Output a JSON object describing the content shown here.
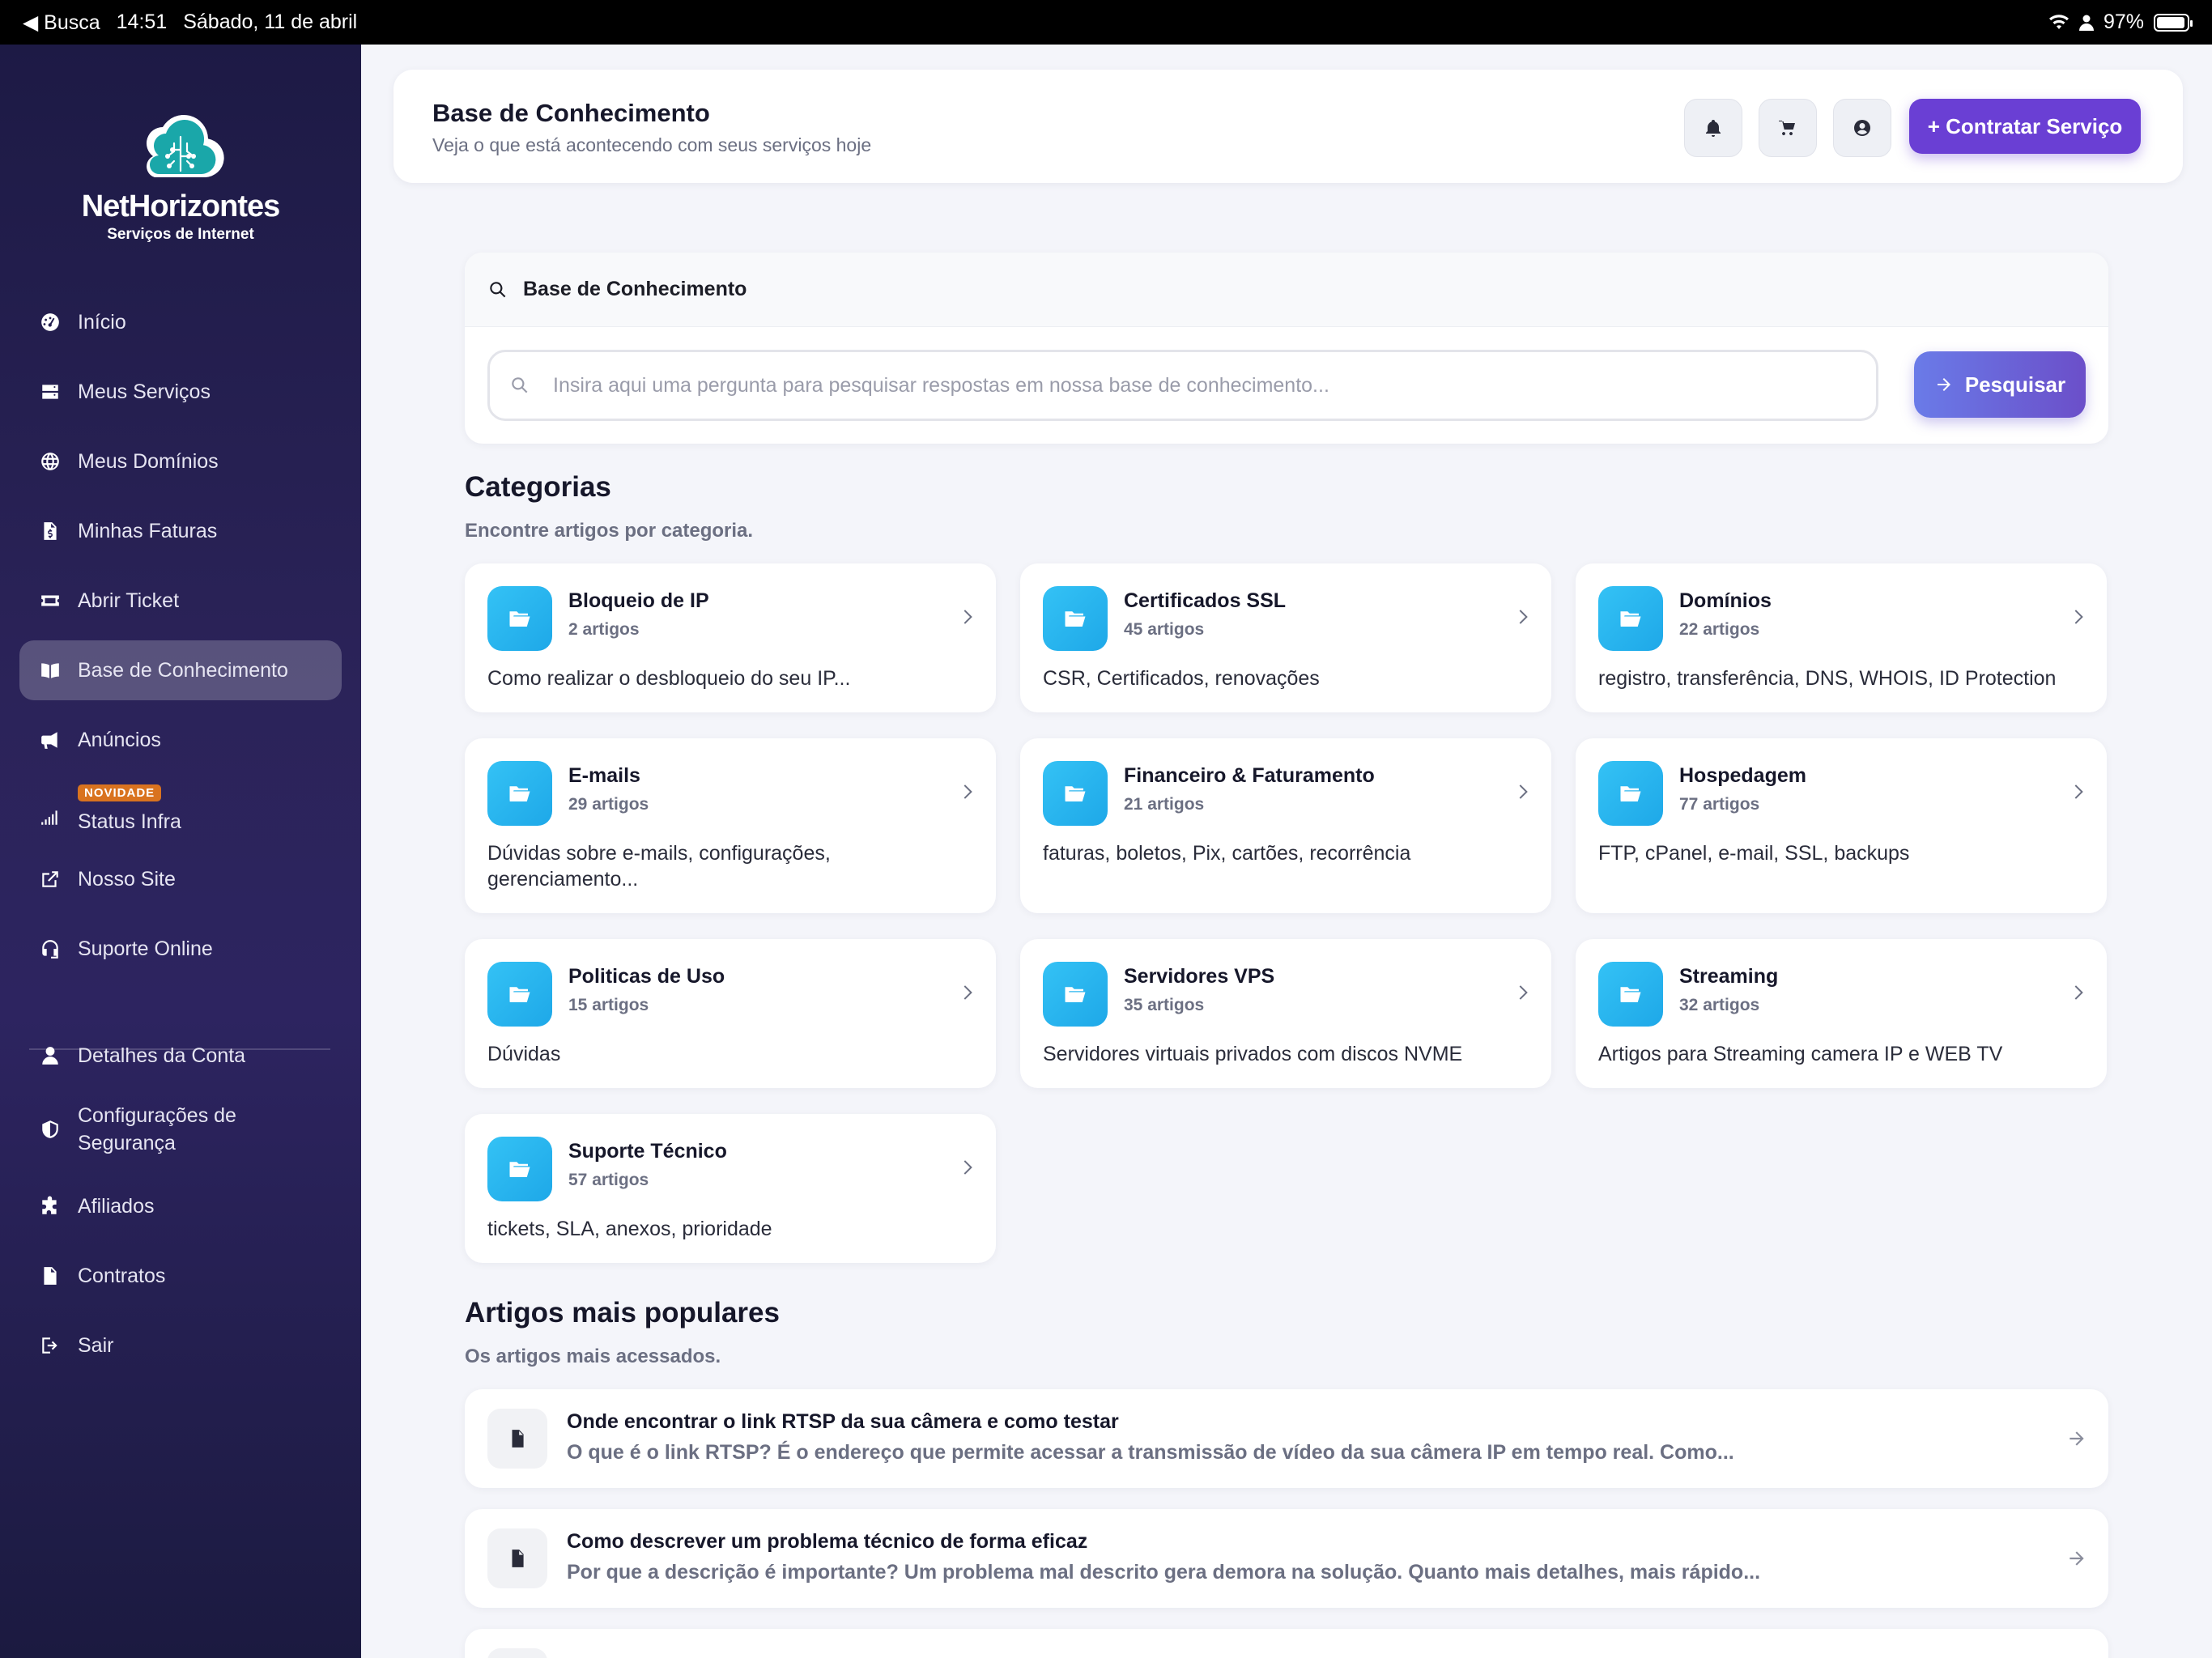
{
  "status_bar": {
    "back": "◀ Busca",
    "time": "14:51",
    "date": "Sábado, 11 de abril",
    "battery": "97%"
  },
  "brand": {
    "name": "NetHorizontes",
    "tagline": "Serviços de Internet"
  },
  "sidebar": {
    "items": [
      {
        "label": "Início",
        "icon": "dashboard-icon"
      },
      {
        "label": "Meus Serviços",
        "icon": "server-icon"
      },
      {
        "label": "Meus Domínios",
        "icon": "globe-icon"
      },
      {
        "label": "Minhas Faturas",
        "icon": "invoice-icon"
      },
      {
        "label": "Abrir Ticket",
        "icon": "ticket-icon"
      },
      {
        "label": "Base de Conhecimento",
        "icon": "book-icon",
        "active": true
      },
      {
        "label": "Anúncios",
        "icon": "megaphone-icon"
      },
      {
        "label": "Status Infra",
        "icon": "signal-icon",
        "badge": "NOVIDADE"
      },
      {
        "label": "Nosso Site",
        "icon": "external-link-icon"
      },
      {
        "label": "Suporte Online",
        "icon": "headset-icon"
      },
      {
        "label": "Detalhes da Conta",
        "icon": "user-icon"
      },
      {
        "label": "Configurações de Segurança",
        "icon": "shield-icon"
      },
      {
        "label": "Afiliados",
        "icon": "puzzle-icon"
      },
      {
        "label": "Contratos",
        "icon": "contract-icon"
      },
      {
        "label": "Sair",
        "icon": "logout-icon"
      }
    ]
  },
  "header": {
    "title": "Base de Conhecimento",
    "subtitle": "Veja o que está acontecendo com seus serviços hoje",
    "cta_label": "+ Contratar Serviço"
  },
  "search": {
    "title": "Base de Conhecimento",
    "placeholder": "Insira aqui uma pergunta para pesquisar respostas em nossa base de conhecimento...",
    "button_label": "Pesquisar"
  },
  "categories": {
    "title": "Categorias",
    "subtitle": "Encontre artigos por categoria.",
    "items": [
      {
        "name": "Bloqueio de IP",
        "count": "2 artigos",
        "desc": "Como realizar o desbloqueio do seu IP..."
      },
      {
        "name": "Certificados SSL",
        "count": "45 artigos",
        "desc": "CSR, Certificados, renovações"
      },
      {
        "name": "Domínios",
        "count": "22 artigos",
        "desc": "registro, transferência, DNS, WHOIS, ID Protection"
      },
      {
        "name": "E-mails",
        "count": "29 artigos",
        "desc": "Dúvidas sobre e-mails, configurações, gerenciamento..."
      },
      {
        "name": "Financeiro & Faturamento",
        "count": "21 artigos",
        "desc": "faturas, boletos, Pix, cartões, recorrência"
      },
      {
        "name": "Hospedagem",
        "count": "77 artigos",
        "desc": "FTP, cPanel, e-mail, SSL, backups"
      },
      {
        "name": "Politicas de Uso",
        "count": "15 artigos",
        "desc": "Dúvidas"
      },
      {
        "name": "Servidores VPS",
        "count": "35 artigos",
        "desc": "Servidores virtuais privados com discos NVME"
      },
      {
        "name": "Streaming",
        "count": "32 artigos",
        "desc": "Artigos para Streaming camera IP e WEB TV"
      },
      {
        "name": "Suporte Técnico",
        "count": "57 artigos",
        "desc": "tickets, SLA, anexos, prioridade"
      }
    ]
  },
  "popular": {
    "title": "Artigos mais populares",
    "subtitle": "Os artigos mais acessados.",
    "items": [
      {
        "title": "Onde encontrar o link RTSP da sua câmera e como testar",
        "snippet": "O que é o link RTSP? É o endereço que permite acessar a transmissão de vídeo da sua câmera IP em tempo real. Como..."
      },
      {
        "title": "Como descrever um problema técnico de forma eficaz",
        "snippet": "Por que a descrição é importante? Um problema mal descrito gera demora na solução. Quanto mais detalhes, mais rápido..."
      }
    ]
  },
  "colors": {
    "accent": "#6a3fd4",
    "sidebar": "#2b2359",
    "folder": "#34c2f5",
    "badge": "#d9731f"
  }
}
